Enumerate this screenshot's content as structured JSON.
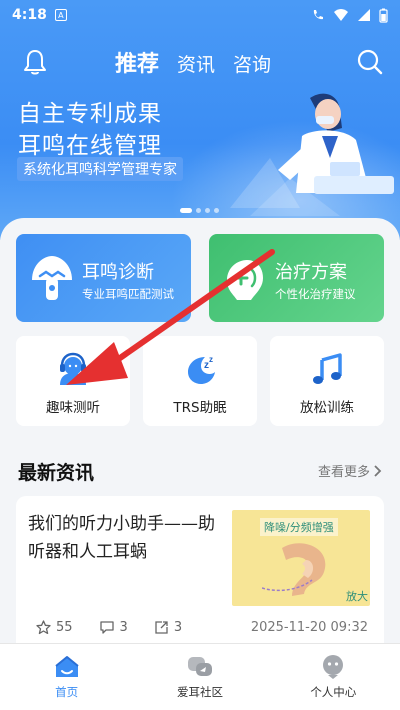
{
  "status_bar": {
    "time": "4:18",
    "notif_letter": "A"
  },
  "top_nav": {
    "tabs": [
      {
        "label": "推荐"
      },
      {
        "label": "资讯"
      },
      {
        "label": "咨询"
      }
    ]
  },
  "banner": {
    "line1": "自主专利成果",
    "line2": "耳鸣在线管理",
    "subtitle": "系统化耳鸣科学管理专家",
    "page_count": 4,
    "active_page": 1
  },
  "feature_cards": [
    {
      "title": "耳鸣诊断",
      "subtitle": "专业耳鸣匹配测试",
      "icon": "mushroom-ear-icon",
      "color": "#3f8ff3"
    },
    {
      "title": "治疗方案",
      "subtitle": "个性化治疗建议",
      "icon": "sound-plus-icon",
      "color": "#3fbf70"
    }
  ],
  "quick_actions": [
    {
      "label": "趣味测听",
      "icon": "headset-person-icon"
    },
    {
      "label": "TRS助眠",
      "icon": "moon-sleep-icon"
    },
    {
      "label": "放松训练",
      "icon": "music-note-icon"
    }
  ],
  "news_section": {
    "title": "最新资讯",
    "see_more": "查看更多"
  },
  "news_item": {
    "title": "我们的听力小助手——助听器和人工耳蜗",
    "image_text": "降噪/分频增强",
    "image_text_corner": "放大",
    "likes": "55",
    "comments": "3",
    "shares": "3",
    "time": "2025-11-20 09:32"
  },
  "bottom_nav": [
    {
      "label": "首页",
      "icon": "home-icon",
      "active": true
    },
    {
      "label": "爱耳社区",
      "icon": "community-chat-icon",
      "active": false
    },
    {
      "label": "个人中心",
      "icon": "user-profile-icon",
      "active": false
    }
  ],
  "colors": {
    "primary_blue": "#3b8df4",
    "green": "#3fbf70",
    "arrow_red": "#e53030"
  }
}
